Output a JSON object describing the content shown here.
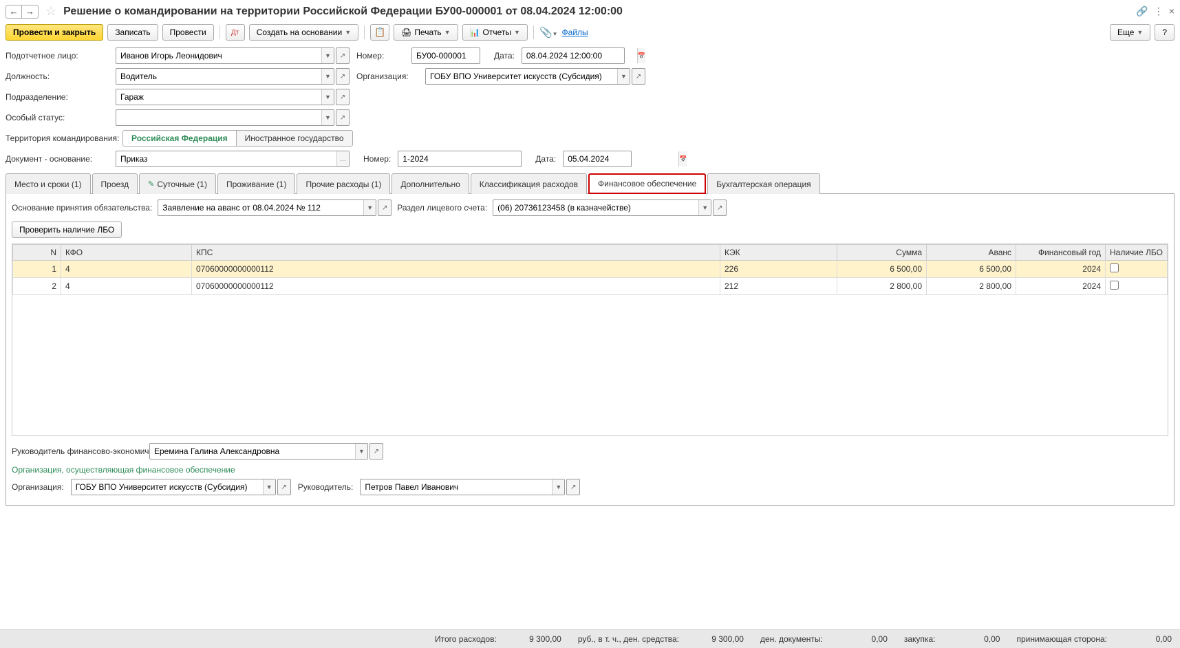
{
  "title": "Решение о командировании на территории Российской Федерации БУ00-000001 от 08.04.2024 12:00:00",
  "toolbar": {
    "post_close": "Провести и закрыть",
    "save": "Записать",
    "post": "Провести",
    "create_based": "Создать на основании",
    "print": "Печать",
    "reports": "Отчеты",
    "files": "Файлы",
    "more": "Еще",
    "help": "?"
  },
  "fields": {
    "person_label": "Подотчетное лицо:",
    "person": "Иванов Игорь Леонидович",
    "position_label": "Должность:",
    "position": "Водитель",
    "dept_label": "Подразделение:",
    "dept": "Гараж",
    "status_label": "Особый статус:",
    "status": "",
    "territory_label": "Территория командирования:",
    "territory_rf": "Российская Федерация",
    "territory_foreign": "Иностранное государство",
    "doc_basis_label": "Документ - основание:",
    "doc_basis": "Приказ",
    "number_label": "Номер:",
    "number": "БУ00-000001",
    "date_label": "Дата:",
    "date": "08.04.2024 12:00:00",
    "org_label": "Организация:",
    "org": "ГОБУ ВПО Университет искусств (Субсидия)",
    "basis_number_label": "Номер:",
    "basis_number": "1-2024",
    "basis_date_label": "Дата:",
    "basis_date": "05.04.2024"
  },
  "tabs": {
    "t1": "Место и сроки (1)",
    "t2": "Проезд",
    "t3": "Суточные (1)",
    "t4": "Проживание (1)",
    "t5": "Прочие расходы (1)",
    "t6": "Дополнительно",
    "t7": "Классификация расходов",
    "t8": "Финансовое обеспечение",
    "t9": "Бухгалтерская операция"
  },
  "fin": {
    "basis_label": "Основание принятия обязательства:",
    "basis": "Заявление на аванс от 08.04.2024 № 112",
    "account_label": "Раздел лицевого счета:",
    "account": "(06) 20736123458 (в казначействе)",
    "check_lbo": "Проверить наличие ЛБО"
  },
  "table": {
    "headers": {
      "n": "N",
      "kfo": "КФО",
      "kps": "КПС",
      "kek": "КЭК",
      "sum": "Сумма",
      "advance": "Аванс",
      "year": "Финансовый год",
      "lbo": "Наличие ЛБО"
    },
    "rows": [
      {
        "n": "1",
        "kfo": "4",
        "kps": "07060000000000112",
        "kek": "226",
        "sum": "6 500,00",
        "advance": "6 500,00",
        "year": "2024",
        "lbo": false,
        "selected": true
      },
      {
        "n": "2",
        "kfo": "4",
        "kps": "07060000000000112",
        "kek": "212",
        "sum": "2 800,00",
        "advance": "2 800,00",
        "year": "2024",
        "lbo": false,
        "selected": false
      }
    ]
  },
  "footer": {
    "fin_head_label": "Руководитель финансово-экономического подразделения:",
    "fin_head": "Еремина Галина Александровна",
    "org_section": "Организация, осуществляющая финансовое обеспечение",
    "org_label": "Организация:",
    "org": "ГОБУ ВПО Университет искусств (Субсидия)",
    "head_label": "Руководитель:",
    "head": "Петров Павел Иванович"
  },
  "totals": {
    "expenses_label": "Итого расходов:",
    "expenses": "9 300,00",
    "rub_label": "руб., в т. ч., ден. средства:",
    "cash": "9 300,00",
    "docs_label": "ден. документы:",
    "docs": "0,00",
    "purchase_label": "закупка:",
    "purchase": "0,00",
    "receiving_label": "принимающая сторона:",
    "receiving": "0,00"
  }
}
